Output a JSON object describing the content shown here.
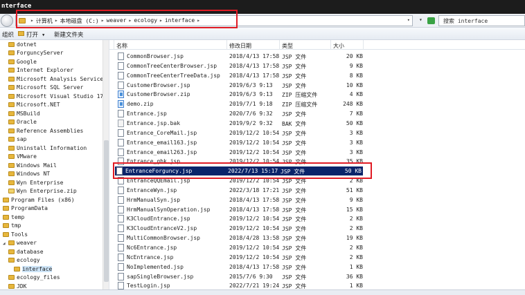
{
  "window": {
    "title": "nterface"
  },
  "address": {
    "crumbs": [
      "计算机",
      "本地磁盘 (C:)",
      "weaver",
      "ecology",
      "interface"
    ]
  },
  "search": {
    "placeholder": "搜索 interface"
  },
  "toolbar": {
    "organize_label": "组织 ▾",
    "open_label": "打开 ▾",
    "new_folder_label": "新建文件夹"
  },
  "tree": {
    "items": [
      {
        "label": "dotnet"
      },
      {
        "label": "ForguncyServer"
      },
      {
        "label": "Google"
      },
      {
        "label": "Internet Explorer"
      },
      {
        "label": "Microsoft Analysis Services"
      },
      {
        "label": "Microsoft SQL Server"
      },
      {
        "label": "Microsoft Visual Studio 17.0"
      },
      {
        "label": "Microsoft.NET"
      },
      {
        "label": "MSBuild"
      },
      {
        "label": "Oracle"
      },
      {
        "label": "Reference Assemblies"
      },
      {
        "label": "sap"
      },
      {
        "label": "Uninstall Information"
      },
      {
        "label": "VMware"
      },
      {
        "label": "Windows Mail"
      },
      {
        "label": "Windows NT"
      },
      {
        "label": "Wyn Enterprise"
      },
      {
        "label": "Wyn Enterprise.zip"
      },
      {
        "label": "Program Files (x86)"
      },
      {
        "label": "ProgramData"
      },
      {
        "label": "temp"
      },
      {
        "label": "tmp"
      },
      {
        "label": "Tools"
      },
      {
        "label": "weaver"
      },
      {
        "label": "database"
      },
      {
        "label": "ecology"
      },
      {
        "label": "interface"
      },
      {
        "label": "ecology_files"
      },
      {
        "label": "JDK"
      }
    ]
  },
  "list": {
    "headers": {
      "name": "名称",
      "date": "修改日期",
      "type": "类型",
      "size": "大小"
    },
    "files": [
      {
        "name": "CommonBrowser.jsp",
        "date": "2018/4/13 17:58",
        "type": "JSP 文件",
        "size": "20 KB",
        "icon": "jsp"
      },
      {
        "name": "CommonTreeCenterBrowser.jsp",
        "date": "2018/4/13 17:58",
        "type": "JSP 文件",
        "size": "9 KB",
        "icon": "jsp"
      },
      {
        "name": "CommonTreeCenterTreeData.jsp",
        "date": "2018/4/13 17:58",
        "type": "JSP 文件",
        "size": "8 KB",
        "icon": "jsp"
      },
      {
        "name": "CustomerBrowser.jsp",
        "date": "2019/6/3 9:13",
        "type": "JSP 文件",
        "size": "10 KB",
        "icon": "jsp"
      },
      {
        "name": "CustomerBrowser.zip",
        "date": "2019/6/3 9:13",
        "type": "ZIP 压缩文件",
        "size": "4 KB",
        "icon": "zip"
      },
      {
        "name": "demo.zip",
        "date": "2019/7/1 9:18",
        "type": "ZIP 压缩文件",
        "size": "248 KB",
        "icon": "zip"
      },
      {
        "name": "Entrance.jsp",
        "date": "2020/7/6 9:32",
        "type": "JSP 文件",
        "size": "7 KB",
        "icon": "jsp"
      },
      {
        "name": "Entrance.jsp.bak",
        "date": "2019/9/2 9:32",
        "type": "BAK 文件",
        "size": "50 KB",
        "icon": "bak"
      },
      {
        "name": "Entrance_CoreMail.jsp",
        "date": "2019/12/2 10:54",
        "type": "JSP 文件",
        "size": "3 KB",
        "icon": "jsp"
      },
      {
        "name": "Entrance_email163.jsp",
        "date": "2019/12/2 10:54",
        "type": "JSP 文件",
        "size": "3 KB",
        "icon": "jsp"
      },
      {
        "name": "Entrance_email263.jsp",
        "date": "2019/12/2 10:54",
        "type": "JSP 文件",
        "size": "3 KB",
        "icon": "jsp"
      },
      {
        "name": "Entrance_gbk.jsp",
        "date": "2019/12/2 10:54",
        "type": "JSP 文件",
        "size": "35 KB",
        "icon": "jsp"
      },
      {
        "name": "EntranceForguncy.jsp",
        "date": "2022/7/13 15:17",
        "type": "JSP 文件",
        "size": "50 KB",
        "icon": "jsp"
      },
      {
        "name": "EntranceQQEmail.jsp",
        "date": "2019/12/2 10:54",
        "type": "JSP 文件",
        "size": "2 KB",
        "icon": "jsp"
      },
      {
        "name": "EntranceWyn.jsp",
        "date": "2022/3/18 17:21",
        "type": "JSP 文件",
        "size": "51 KB",
        "icon": "jsp"
      },
      {
        "name": "HrmManualSyn.jsp",
        "date": "2018/4/13 17:58",
        "type": "JSP 文件",
        "size": "9 KB",
        "icon": "jsp"
      },
      {
        "name": "HrmManualSynOperation.jsp",
        "date": "2018/4/13 17:58",
        "type": "JSP 文件",
        "size": "15 KB",
        "icon": "jsp"
      },
      {
        "name": "K3CloudEntrance.jsp",
        "date": "2019/12/2 10:54",
        "type": "JSP 文件",
        "size": "2 KB",
        "icon": "jsp"
      },
      {
        "name": "K3CloudEntranceV2.jsp",
        "date": "2019/12/2 10:54",
        "type": "JSP 文件",
        "size": "2 KB",
        "icon": "jsp"
      },
      {
        "name": "MultiCommonBrowser.jsp",
        "date": "2018/4/28 13:58",
        "type": "JSP 文件",
        "size": "19 KB",
        "icon": "jsp"
      },
      {
        "name": "Nc6Entrance.jsp",
        "date": "2019/12/2 10:54",
        "type": "JSP 文件",
        "size": "2 KB",
        "icon": "jsp"
      },
      {
        "name": "NcEntrance.jsp",
        "date": "2019/12/2 10:54",
        "type": "JSP 文件",
        "size": "2 KB",
        "icon": "jsp"
      },
      {
        "name": "NoImplemented.jsp",
        "date": "2018/4/13 17:58",
        "type": "JSP 文件",
        "size": "1 KB",
        "icon": "jsp"
      },
      {
        "name": "sapSingleBrowser.jsp",
        "date": "2015/7/6 9:30",
        "type": "JSP 文件",
        "size": "36 KB",
        "icon": "jsp"
      },
      {
        "name": "TestLogin.jsp",
        "date": "2022/7/21 19:24",
        "type": "JSP 文件",
        "size": "1 KB",
        "icon": "jsp"
      }
    ]
  }
}
